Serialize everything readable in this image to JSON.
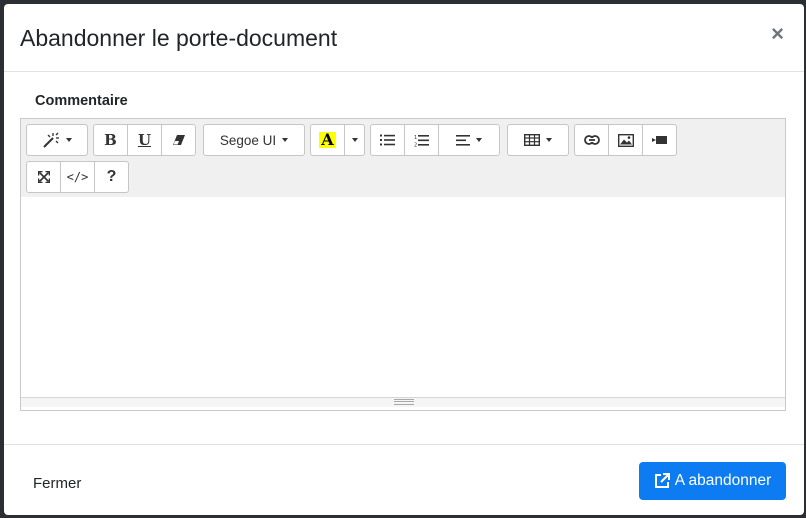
{
  "dialog": {
    "title": "Abandonner le porte-document",
    "close_glyph": "×"
  },
  "form": {
    "comment_label": "Commentaire"
  },
  "toolbar": {
    "font_name": "Segoe UI",
    "help_label": "?",
    "code_view_label": "</>",
    "highlight_color": "#ffff00",
    "icons": [
      "magic-icon",
      "bold-icon",
      "underline-icon",
      "eraser-icon",
      "font-color-icon",
      "bullet-list-icon",
      "ordered-list-icon",
      "align-icon",
      "table-icon",
      "link-icon",
      "picture-icon",
      "video-icon",
      "fullscreen-icon",
      "code-view-icon",
      "help-icon"
    ]
  },
  "footer": {
    "close_label": "Fermer",
    "submit_label": "A abandonner",
    "submit_color": "#0d7cf2"
  }
}
